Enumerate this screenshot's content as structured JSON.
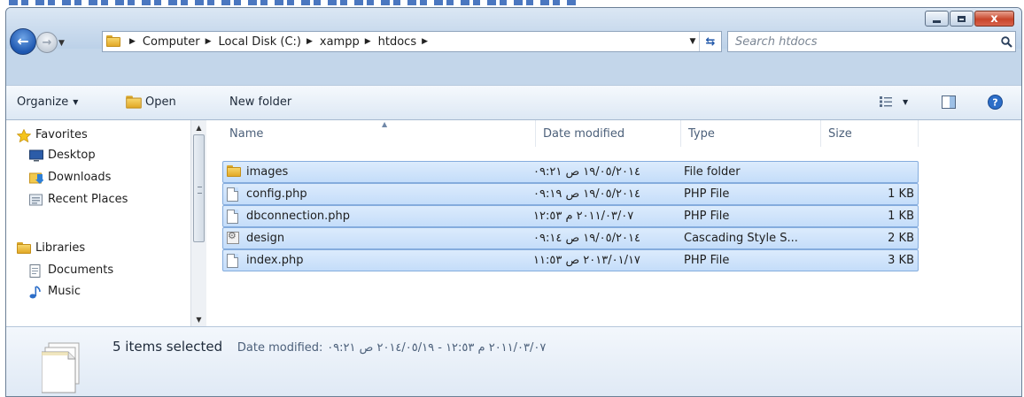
{
  "window": {
    "caption_buttons": [
      {
        "name": "minimize",
        "icon": "minimize-icon"
      },
      {
        "name": "maximize",
        "icon": "maximize-icon"
      },
      {
        "name": "close",
        "icon": "close-icon",
        "glyph": "x"
      }
    ]
  },
  "navigation": {
    "back_icon": "back-arrow-icon",
    "forward_icon": "forward-arrow-icon",
    "breadcrumbs": [
      "Computer",
      "Local Disk (C:)",
      "xampp",
      "htdocs"
    ],
    "search_placeholder": "Search htdocs"
  },
  "toolbar": {
    "organize_label": "Organize",
    "open_label": "Open",
    "new_folder_label": "New folder"
  },
  "nav_pane": {
    "items": [
      {
        "label": "Favorites",
        "icon": "star-icon",
        "level": 0
      },
      {
        "label": "Desktop",
        "icon": "desktop-icon",
        "level": 1
      },
      {
        "label": "Downloads",
        "icon": "downloads-icon",
        "level": 1
      },
      {
        "label": "Recent Places",
        "icon": "recent-places-icon",
        "level": 1
      },
      {
        "label": "Libraries",
        "icon": "libraries-icon",
        "level": 0
      },
      {
        "label": "Documents",
        "icon": "documents-icon",
        "level": 1
      },
      {
        "label": "Music",
        "icon": "music-icon",
        "level": 1
      }
    ]
  },
  "file_list": {
    "columns": [
      "Name",
      "Date modified",
      "Type",
      "Size"
    ],
    "rows": [
      {
        "name": "images",
        "date": "۲۰۱٤/۰٥/۱۹ ص ۰۹:۲۱",
        "type": "File folder",
        "size": "",
        "icon": "folder-icon"
      },
      {
        "name": "config.php",
        "date": "۲۰۱٤/۰٥/۱۹ ص ۰۹:۱۹",
        "type": "PHP File",
        "size": "1 KB",
        "icon": "file-icon"
      },
      {
        "name": "dbconnection.php",
        "date": "۲۰۱۱/۰۳/۰۷ م ۱۲:٥۳",
        "type": "PHP File",
        "size": "1 KB",
        "icon": "file-icon"
      },
      {
        "name": "design",
        "date": "۲۰۱٤/۰٥/۱۹ ص ۰۹:۱٤",
        "type": "Cascading Style S...",
        "size": "2 KB",
        "icon": "css-file-icon"
      },
      {
        "name": "index.php",
        "date": "۲۰۱۳/۰۱/۱۷ ص ۱۱:٥۳",
        "type": "PHP File",
        "size": "3 KB",
        "icon": "file-icon"
      }
    ]
  },
  "details_pane": {
    "selection": "5 items selected",
    "date_label": "Date modified:",
    "date_range": "۲۰۱۱/۰۳/۰۷ م ۱۲:٥۳ - ۲۰۱٤/۰٥/۱۹ ص ۰۹:۲۱"
  }
}
